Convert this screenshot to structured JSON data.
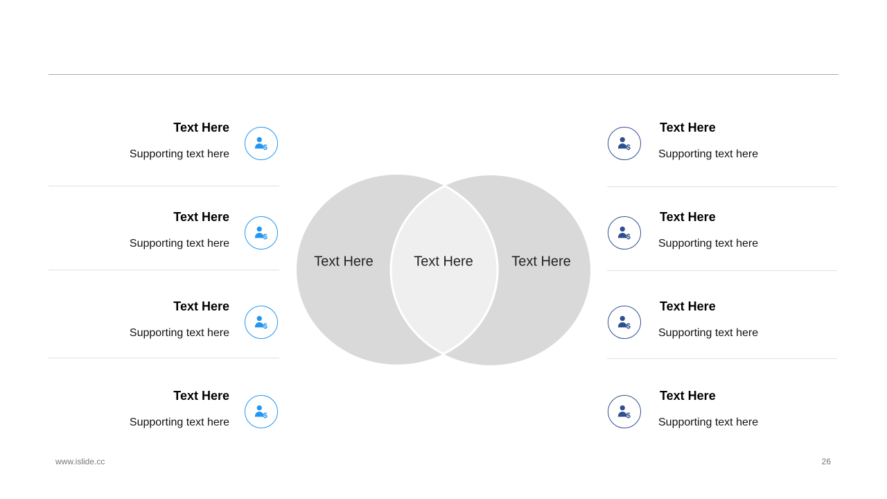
{
  "left_items": [
    {
      "title": "Text Here",
      "subtitle": "Supporting text here",
      "icon": "user-dollar-icon"
    },
    {
      "title": "Text Here",
      "subtitle": "Supporting text here",
      "icon": "user-dollar-icon"
    },
    {
      "title": "Text Here",
      "subtitle": "Supporting text here",
      "icon": "user-dollar-icon"
    },
    {
      "title": "Text Here",
      "subtitle": "Supporting text here",
      "icon": "user-dollar-icon"
    }
  ],
  "right_items": [
    {
      "title": "Text Here",
      "subtitle": "Supporting text here",
      "icon": "user-dollar-icon"
    },
    {
      "title": "Text Here",
      "subtitle": "Supporting text here",
      "icon": "user-dollar-icon"
    },
    {
      "title": "Text Here",
      "subtitle": "Supporting text here",
      "icon": "user-dollar-icon"
    },
    {
      "title": "Text Here",
      "subtitle": "Supporting text here",
      "icon": "user-dollar-icon"
    }
  ],
  "venn": {
    "left_label": "Text Here",
    "center_label": "Text Here",
    "right_label": "Text Here"
  },
  "footer": {
    "url": "www.islide.cc",
    "page_number": "26"
  },
  "colors": {
    "left_icon_accent": "#2196f3",
    "right_icon_accent": "#2f4f8f",
    "circle_fill": "#d9d9d9",
    "intersection_fill": "#efefef"
  }
}
